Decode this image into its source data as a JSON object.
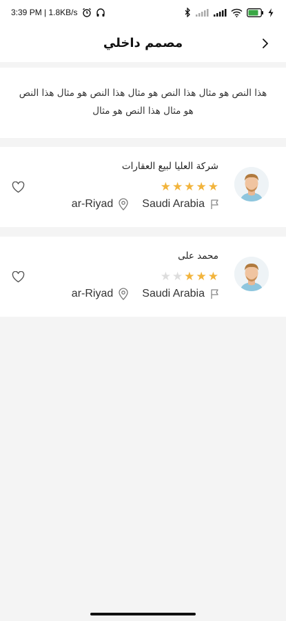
{
  "status_bar": {
    "time_speed": "3:39 PM | 1.8KB/s",
    "battery": "78"
  },
  "header": {
    "title": "مصمم داخلي"
  },
  "description": "هذا النص هو مثال هذا النص هو مثال هذا النص هو مثال هذا النص هو مثال هذا النص هو مثال",
  "designers": [
    {
      "name": "شركة العليا لبيع العقارات",
      "rating": 5,
      "country": "Saudi Arabia",
      "city": "ar-Riyad"
    },
    {
      "name": "محمد على",
      "rating": 3,
      "country": "Saudi Arabia",
      "city": "ar-Riyad"
    }
  ],
  "colors": {
    "star_filled": "#f2b43c",
    "star_empty": "#dddddd"
  }
}
